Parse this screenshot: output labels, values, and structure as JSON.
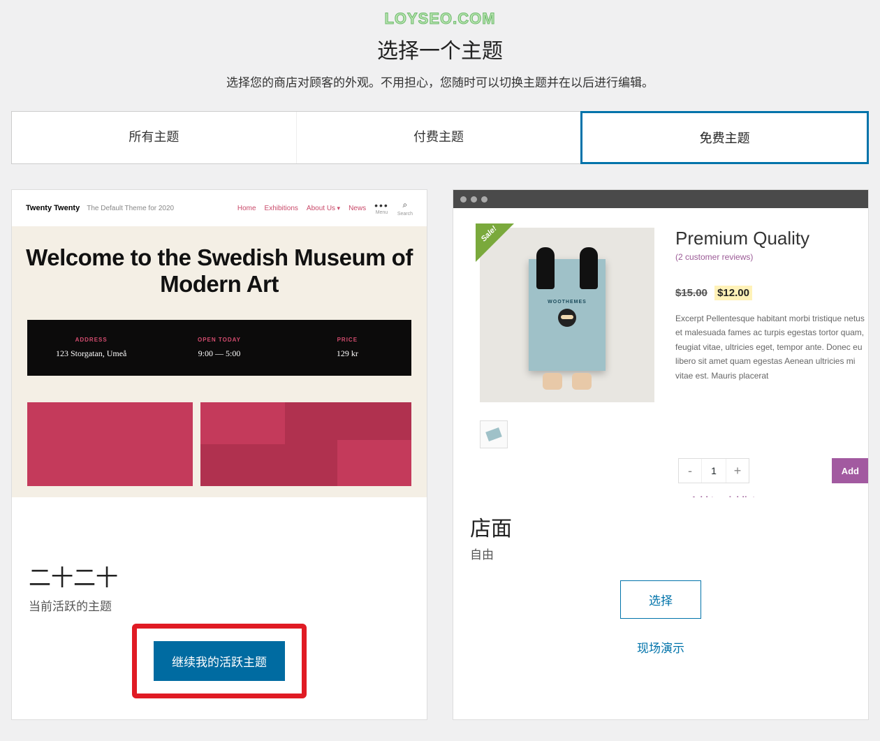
{
  "watermark": "LOYSEO.COM",
  "header": {
    "title": "选择一个主题",
    "subtitle": "选择您的商店对顾客的外观。不用担心，您随时可以切换主题并在以后进行编辑。"
  },
  "tabs": [
    {
      "label": "所有主题",
      "active": false
    },
    {
      "label": "付费主题",
      "active": false
    },
    {
      "label": "免费主题",
      "active": true
    }
  ],
  "card1": {
    "preview": {
      "brand": "Twenty Twenty",
      "tagline": "The Default Theme for 2020",
      "nav": [
        "Home",
        "Exhibitions",
        "About Us",
        "News"
      ],
      "menu_label": "Menu",
      "search_label": "Search",
      "hero": "Welcome to the Swedish Museum of Modern Art",
      "info": {
        "address_label": "ADDRESS",
        "address_value": "123 Storgatan, Umeå",
        "open_label": "OPEN TODAY",
        "open_value": "9:00 — 5:00",
        "price_label": "PRICE",
        "price_value": "129 kr"
      }
    },
    "title": "二十二十",
    "subtitle": "当前活跃的主题",
    "button": "继续我的活跃主题"
  },
  "card2": {
    "preview": {
      "sale": "Sale!",
      "product_title": "Premium Quality",
      "reviews": "(2 customer reviews)",
      "old_price": "$15.00",
      "new_price": "$12.00",
      "excerpt": "Excerpt Pellentesque habitant morbi tristique netus et malesuada fames ac turpis egestas tortor quam, feugiat vitae, ultricies eget, tempor ante. Donec eu libero sit amet quam egestas Aenean ultricies mi vitae est. Mauris placerat",
      "qty": "1",
      "add_label": "Add",
      "wishlist": "Add to wishlist"
    },
    "title": "店面",
    "subtitle": "自由",
    "select": "选择",
    "demo": "现场演示"
  }
}
